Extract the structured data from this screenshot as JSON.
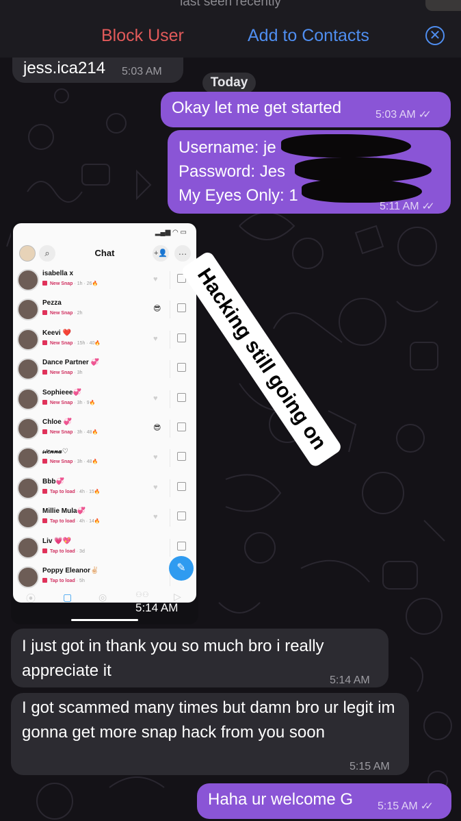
{
  "header": {
    "last_seen": "last seen recently",
    "block_label": "Block User",
    "add_contact_label": "Add to Contacts",
    "close_icon": "✕"
  },
  "colors": {
    "outgoing_bubble": "#8a55d6",
    "incoming_bubble": "#2c2b31",
    "block": "#e25a5a",
    "accent": "#4f8ef0",
    "background": "#141217"
  },
  "messages": [
    {
      "direction": "in",
      "text": "jess.ica214",
      "time": "5:03 AM"
    },
    {
      "direction": "out",
      "text": "Okay let me get started",
      "time": "5:03 AM",
      "status": "read"
    },
    {
      "direction": "out",
      "lines": [
        "Username: je",
        "Password: Jes",
        "My Eyes Only: 1"
      ],
      "time": "5:11 AM",
      "status": "read"
    },
    {
      "direction": "in",
      "type": "image",
      "time": "5:14 AM"
    },
    {
      "direction": "in",
      "text": "I just got in thank you so much bro i really appreciate it",
      "time": "5:14 AM"
    },
    {
      "direction": "in",
      "text": "I got scammed many times but damn bro ur legit im gonna get more snap hack from you soon",
      "time": "5:15 AM"
    },
    {
      "direction": "out",
      "text": "Haha ur welcome G",
      "time": "5:15 AM",
      "status": "read"
    }
  ],
  "date_divider": "Today",
  "sticker_text": "Hacking still going on",
  "screenshot": {
    "title": "Chat",
    "fab_icon": "new-chat-icon",
    "rows": [
      {
        "name": "isabella x",
        "status": "New Snap",
        "time": "1h",
        "streak": "26"
      },
      {
        "name": "Pezza",
        "status": "New Snap",
        "time": "2h",
        "streak": ""
      },
      {
        "name": "Keevi ❤️",
        "status": "New Snap",
        "time": "15h",
        "streak": "40"
      },
      {
        "name": "Dance Partner 💞",
        "status": "New Snap",
        "time": "3h",
        "streak": ""
      },
      {
        "name": "Sophieee💞",
        "status": "New Snap",
        "time": "3h",
        "streak": "9"
      },
      {
        "name": "Chloe 💞",
        "status": "New Snap",
        "time": "3h",
        "streak": "48"
      },
      {
        "name": "𝓈𝒾𝑒𝓃𝓃𝒶♡",
        "status": "New Snap",
        "time": "3h",
        "streak": "48"
      },
      {
        "name": "Bbb💞",
        "status": "Tap to load",
        "time": "4h",
        "streak": "15"
      },
      {
        "name": "Millie Mula💞",
        "status": "Tap to load",
        "time": "4h",
        "streak": "14"
      },
      {
        "name": "Liv 💗💖",
        "status": "Tap to load",
        "time": "3d",
        "streak": ""
      },
      {
        "name": "Poppy Eleanor✌🏻",
        "status": "Tap to load",
        "time": "5h",
        "streak": ""
      }
    ]
  }
}
